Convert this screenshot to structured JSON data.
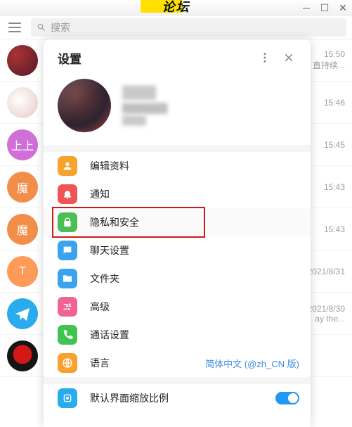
{
  "window": {
    "title": "论坛"
  },
  "search": {
    "placeholder": "搜索"
  },
  "chats": [
    {
      "time": "15:50",
      "snippet": "直持续..."
    },
    {
      "time": "15:46",
      "snippet": ""
    },
    {
      "time": "15:45",
      "snippet": ""
    },
    {
      "time": "15:43",
      "snippet": ""
    },
    {
      "time": "15:43",
      "snippet": ""
    },
    {
      "time": "2021/8/31",
      "snippet": ""
    },
    {
      "time": "2021/8/30",
      "snippet": "ay the..."
    },
    {
      "time": "",
      "snippet": ""
    }
  ],
  "avatar_text": [
    "",
    "",
    "上上",
    "魔",
    "魔",
    "T",
    "",
    ""
  ],
  "modal": {
    "title": "设置",
    "profile": {
      "name": "████",
      "phone": "███████",
      "username": "████"
    },
    "items": {
      "edit": {
        "label": "编辑资料",
        "color": "#f7a12e"
      },
      "notify": {
        "label": "通知",
        "color": "#f05454"
      },
      "privacy": {
        "label": "隐私和安全",
        "color": "#4bbf56"
      },
      "chat": {
        "label": "聊天设置",
        "color": "#3aa2ef"
      },
      "folders": {
        "label": "文件夹",
        "color": "#3aa2ef"
      },
      "advanced": {
        "label": "高级",
        "color": "#f06495"
      },
      "calls": {
        "label": "通话设置",
        "color": "#40c351"
      },
      "lang": {
        "label": "语言",
        "sub": "简体中文 (@zh_CN 版)",
        "color": "#f7a12e"
      },
      "scale": {
        "label": "默认界面缩放比例",
        "color": "#2aabee"
      }
    }
  }
}
